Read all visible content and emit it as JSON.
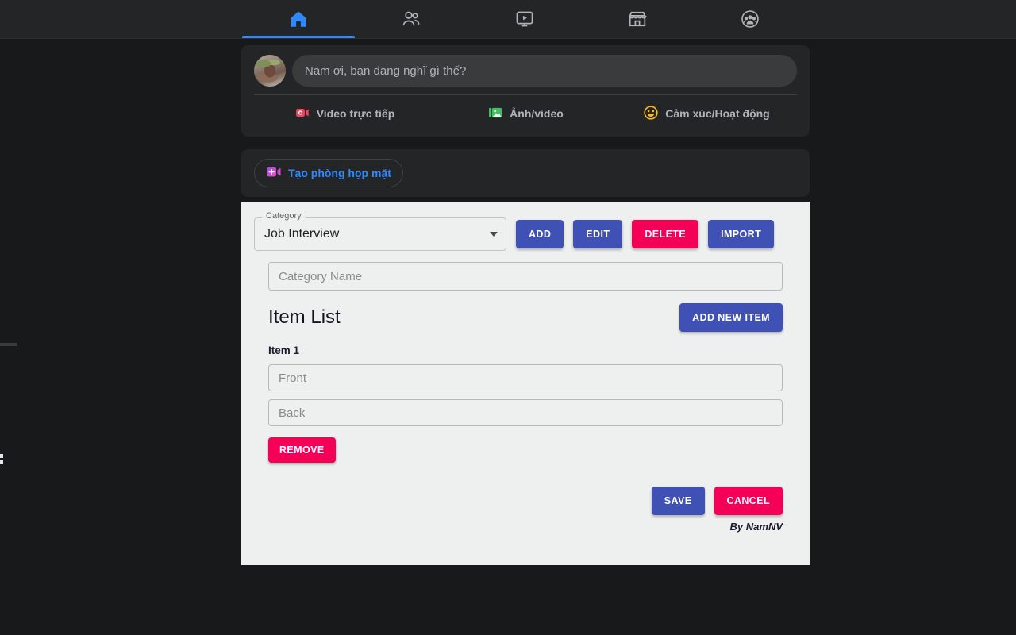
{
  "topnav": {
    "tabs": [
      {
        "name": "home",
        "icon": "home-icon",
        "active": true
      },
      {
        "name": "friends",
        "icon": "friends-icon",
        "active": false
      },
      {
        "name": "watch",
        "icon": "watch-video-icon",
        "active": false
      },
      {
        "name": "marketplace",
        "icon": "marketplace-icon",
        "active": false
      },
      {
        "name": "groups",
        "icon": "groups-icon",
        "active": false
      }
    ],
    "active_color": "#2e89ff",
    "inactive_color": "#b0b3b8",
    "bar_background": "#242526"
  },
  "composer": {
    "avatar_alt": "user-avatar-food-photo",
    "input_placeholder": "Nam ơi, bạn đang nghĩ gì thế?",
    "input_value": "",
    "actions": [
      {
        "label": "Video trực tiếp",
        "icon": "live-video-icon",
        "color": "#f3425f"
      },
      {
        "label": "Ảnh/video",
        "icon": "photo-video-icon",
        "color": "#45bd62"
      },
      {
        "label": "Cảm xúc/Hoạt động",
        "icon": "emoji-smile-icon",
        "color": "#f7b928"
      }
    ]
  },
  "rooms": {
    "button_label": "Tạo phòng họp mặt",
    "button_icon": "create-room-video-icon",
    "button_color": "#2e89ff"
  },
  "appcard": {
    "category_select": {
      "legend": "Category",
      "value": "Job Interview",
      "options": [
        "Job Interview"
      ]
    },
    "toolbar_buttons": [
      {
        "label": "ADD",
        "style": "primary"
      },
      {
        "label": "EDIT",
        "style": "primary"
      },
      {
        "label": "DELETE",
        "style": "danger"
      },
      {
        "label": "IMPORT",
        "style": "primary"
      }
    ],
    "category_name_input": {
      "placeholder": "Category Name",
      "value": ""
    },
    "list_title": "Item List",
    "add_new_item_label": "ADD NEW ITEM",
    "items": [
      {
        "label": "Item 1",
        "front": {
          "placeholder": "Front",
          "value": ""
        },
        "back": {
          "placeholder": "Back",
          "value": ""
        },
        "remove_label": "REMOVE"
      }
    ],
    "save_label": "SAVE",
    "cancel_label": "CANCEL",
    "signature": "By NamNV",
    "colors": {
      "card_background": "#eef0ef",
      "primary": "#3f51b5",
      "danger": "#f50057"
    }
  }
}
